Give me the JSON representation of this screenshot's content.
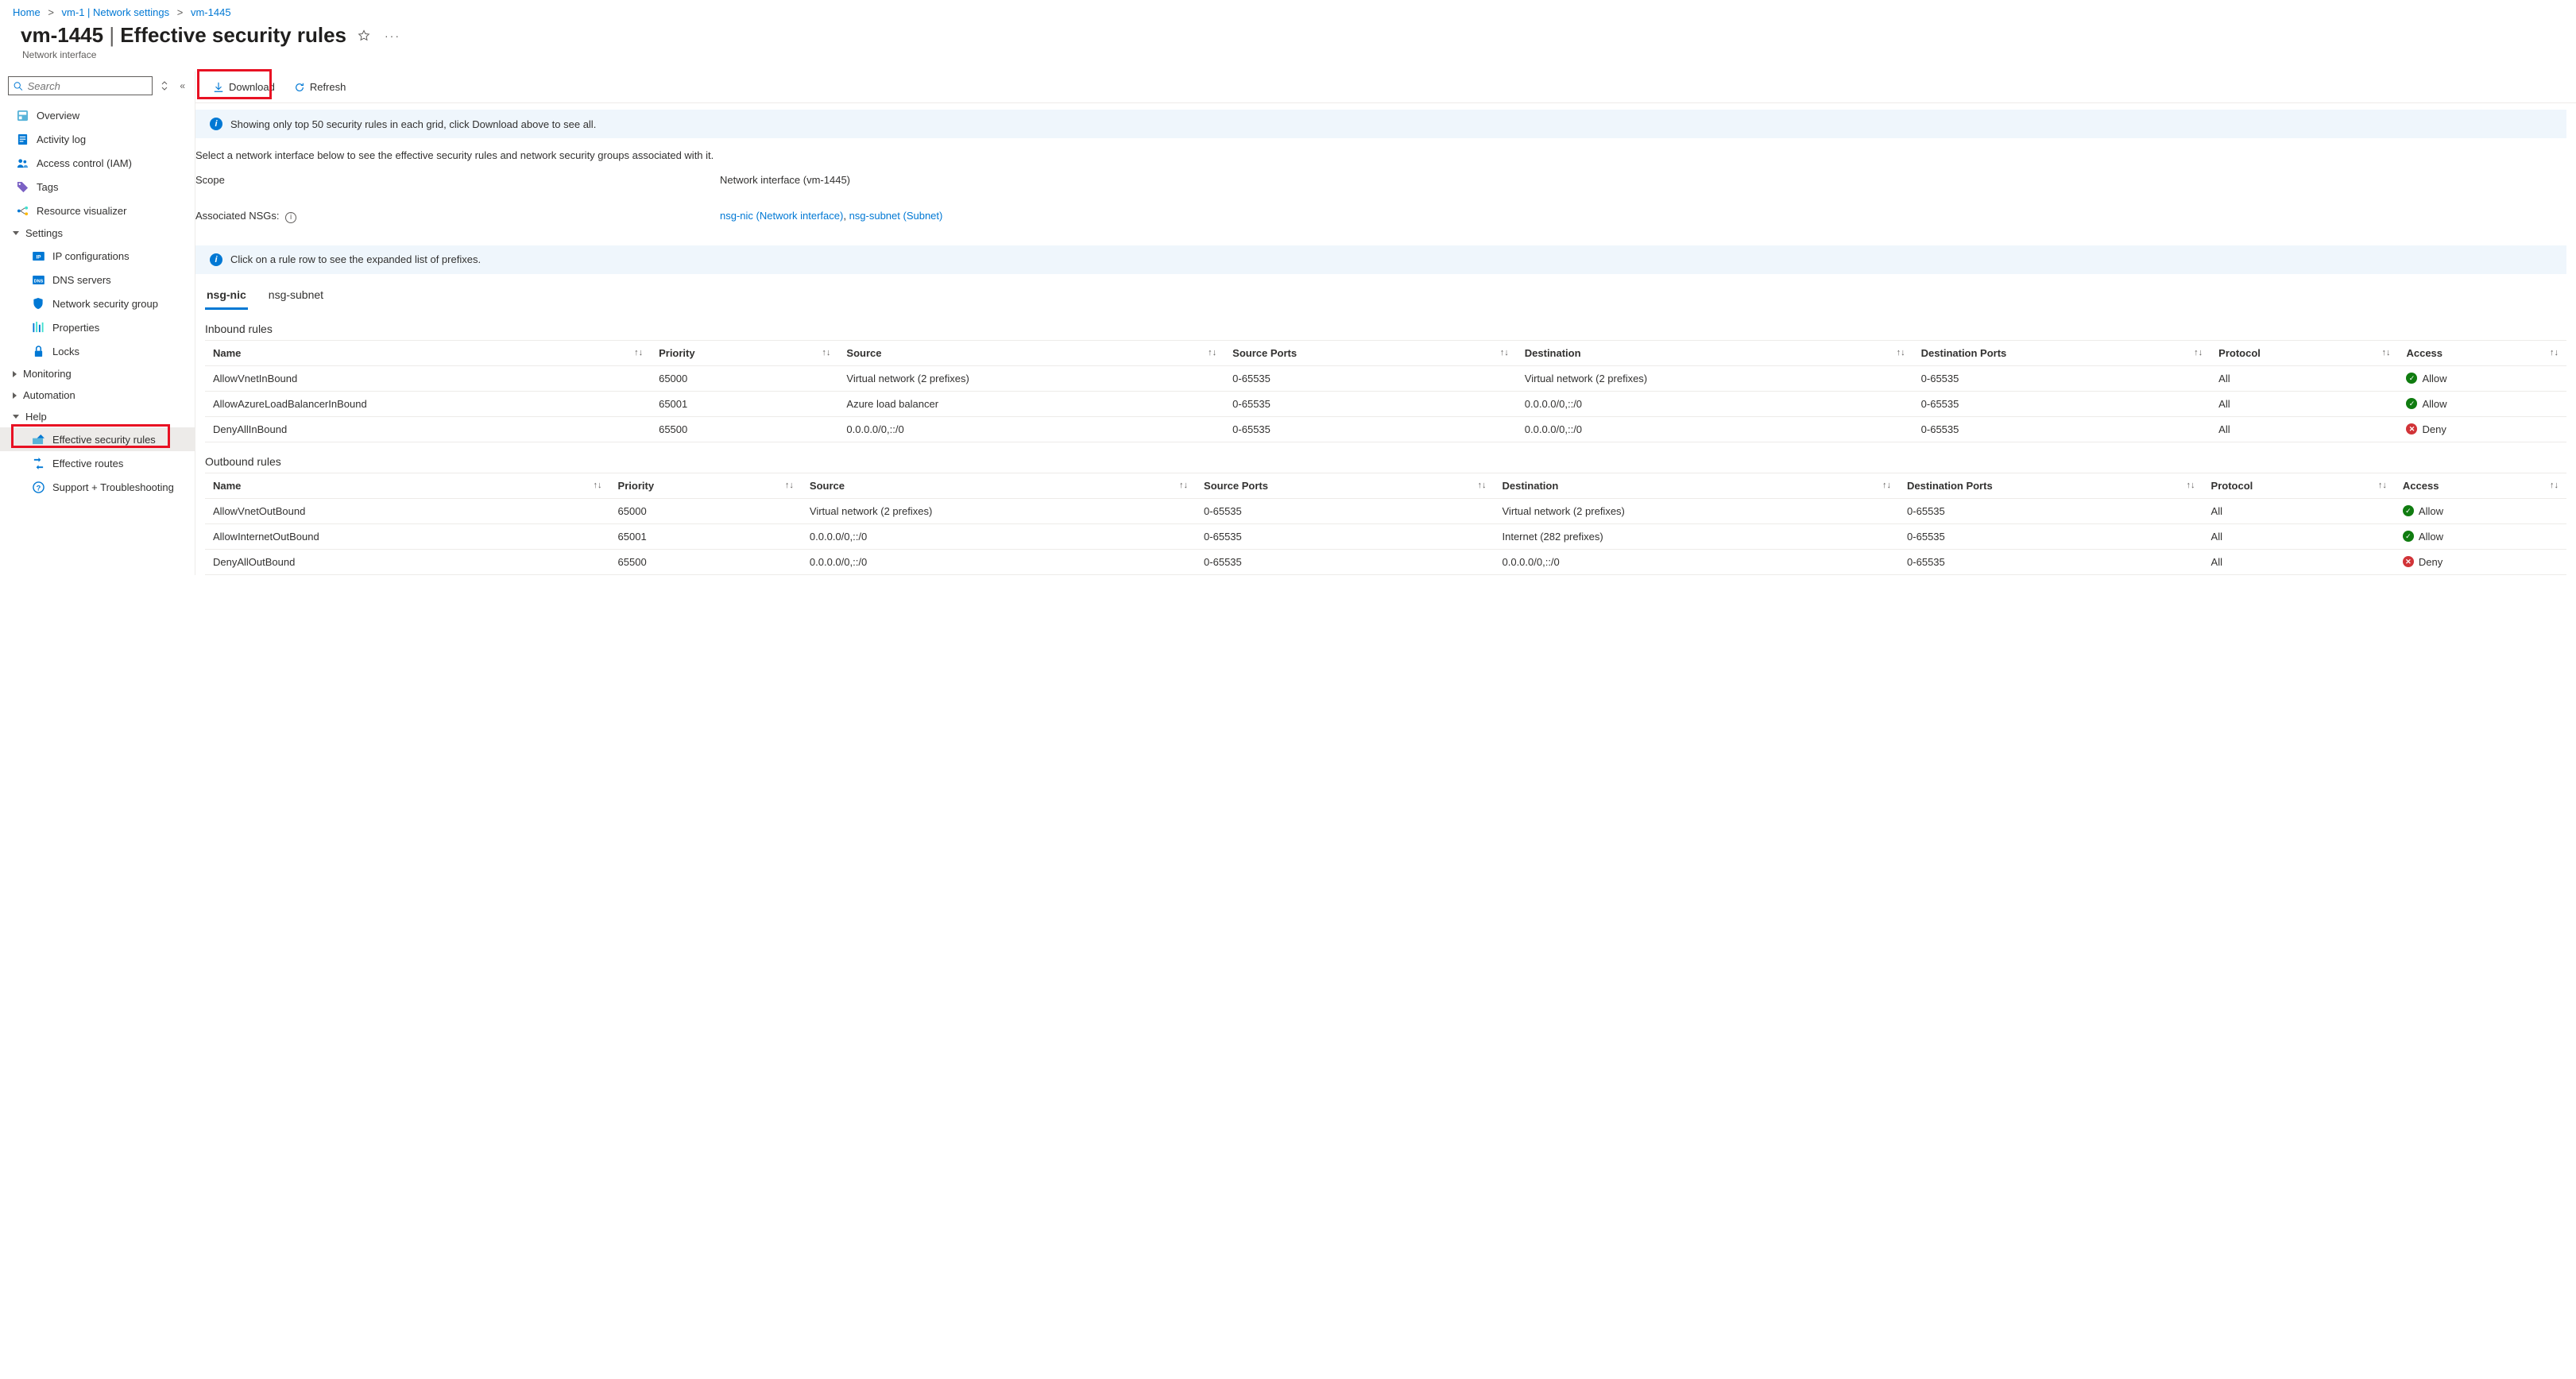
{
  "breadcrumb": [
    {
      "label": "Home"
    },
    {
      "label": "vm-1 | Network settings"
    },
    {
      "label": "vm-1445"
    }
  ],
  "title": {
    "resource": "vm-1445",
    "page": "Effective security rules"
  },
  "subtitle": "Network interface",
  "search": {
    "placeholder": "Search"
  },
  "nav": {
    "overview": "Overview",
    "activity_log": "Activity log",
    "access_control": "Access control (IAM)",
    "tags": "Tags",
    "resource_visualizer": "Resource visualizer",
    "settings": "Settings",
    "ip_config": "IP configurations",
    "dns": "DNS servers",
    "nsg": "Network security group",
    "properties": "Properties",
    "locks": "Locks",
    "monitoring": "Monitoring",
    "automation": "Automation",
    "help": "Help",
    "eff_rules": "Effective security rules",
    "eff_routes": "Effective routes",
    "support": "Support + Troubleshooting"
  },
  "toolbar": {
    "download": "Download",
    "refresh": "Refresh"
  },
  "info1": "Showing only top 50 security rules in each grid, click Download above to see all.",
  "desc": "Select a network interface below to see the effective security rules and network security groups associated with it.",
  "fields": {
    "scope": "Scope",
    "scope_value": "Network interface (vm-1445)",
    "assoc": "Associated NSGs:",
    "assoc_links": [
      "nsg-nic (Network interface)",
      "nsg-subnet (Subnet)"
    ]
  },
  "info2": "Click on a rule row to see the expanded list of prefixes.",
  "tabs": [
    {
      "label": "nsg-nic",
      "active": true
    },
    {
      "label": "nsg-subnet",
      "active": false
    }
  ],
  "sections": {
    "inbound": "Inbound rules",
    "outbound": "Outbound rules"
  },
  "columns": {
    "name": "Name",
    "priority": "Priority",
    "source": "Source",
    "sports": "Source Ports",
    "dest": "Destination",
    "dports": "Destination Ports",
    "proto": "Protocol",
    "access": "Access"
  },
  "inbound_rules": [
    {
      "name": "AllowVnetInBound",
      "priority": "65000",
      "source": "Virtual network (2 prefixes)",
      "sports": "0-65535",
      "dest": "Virtual network (2 prefixes)",
      "dports": "0-65535",
      "proto": "All",
      "access": "Allow"
    },
    {
      "name": "AllowAzureLoadBalancerInBound",
      "priority": "65001",
      "source": "Azure load balancer",
      "sports": "0-65535",
      "dest": "0.0.0.0/0,::/0",
      "dports": "0-65535",
      "proto": "All",
      "access": "Allow"
    },
    {
      "name": "DenyAllInBound",
      "priority": "65500",
      "source": "0.0.0.0/0,::/0",
      "sports": "0-65535",
      "dest": "0.0.0.0/0,::/0",
      "dports": "0-65535",
      "proto": "All",
      "access": "Deny"
    }
  ],
  "outbound_rules": [
    {
      "name": "AllowVnetOutBound",
      "priority": "65000",
      "source": "Virtual network (2 prefixes)",
      "sports": "0-65535",
      "dest": "Virtual network (2 prefixes)",
      "dports": "0-65535",
      "proto": "All",
      "access": "Allow"
    },
    {
      "name": "AllowInternetOutBound",
      "priority": "65001",
      "source": "0.0.0.0/0,::/0",
      "sports": "0-65535",
      "dest": "Internet (282 prefixes)",
      "dports": "0-65535",
      "proto": "All",
      "access": "Allow"
    },
    {
      "name": "DenyAllOutBound",
      "priority": "65500",
      "source": "0.0.0.0/0,::/0",
      "sports": "0-65535",
      "dest": "0.0.0.0/0,::/0",
      "dports": "0-65535",
      "proto": "All",
      "access": "Deny"
    }
  ]
}
